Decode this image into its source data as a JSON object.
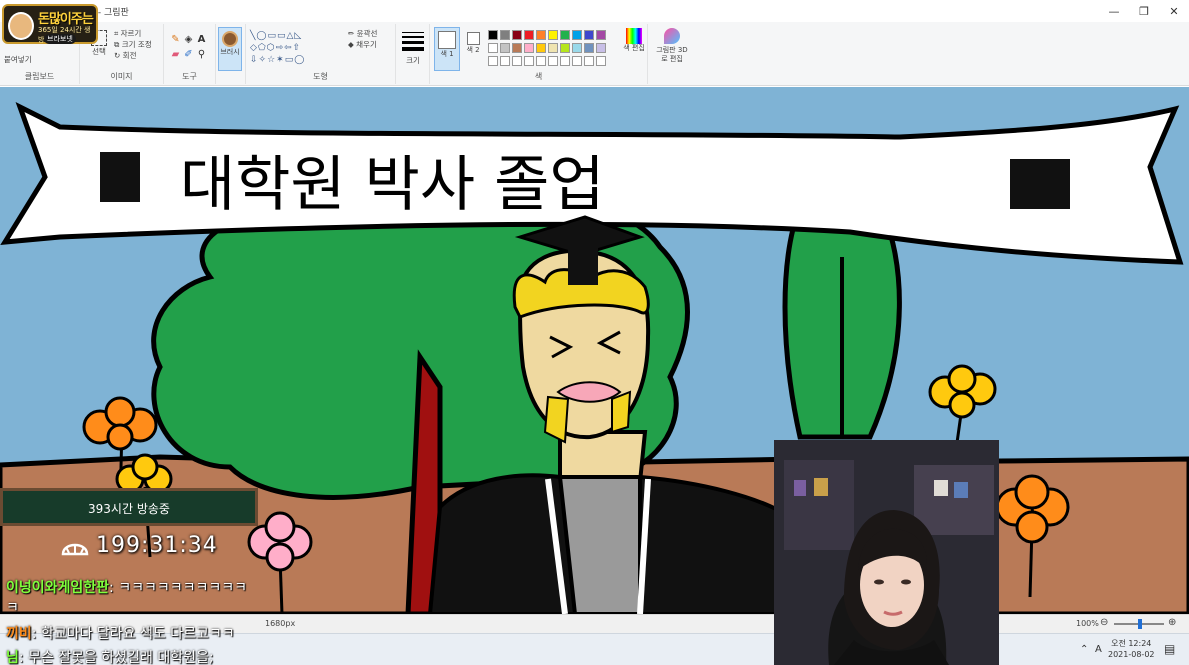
{
  "window": {
    "title": "제목 없음 - 그림판",
    "controls": [
      "—",
      "❐",
      "✕"
    ]
  },
  "ribbon": {
    "clipboard": {
      "paste_label": "붙여넣기",
      "group_label": "클립보드"
    },
    "image": {
      "select_label": "선택",
      "crop_label": "자르기",
      "resize_label": "크기 조정",
      "rotate_label": "회전",
      "group_label": "이미지"
    },
    "tools": {
      "group_label": "도구"
    },
    "brushes": {
      "label": "브러시"
    },
    "shapes": {
      "outline_label": "윤곽선",
      "fill_label": "채우기",
      "group_label": "도형"
    },
    "size": {
      "label": "크기"
    },
    "colors": {
      "color1_label": "색 1",
      "color2_label": "색 2",
      "edit_label": "색 편집",
      "group_label": "색",
      "palette_row1": [
        "#000000",
        "#7f7f7f",
        "#880015",
        "#ed1c24",
        "#ff7f27",
        "#fff200",
        "#22b14c",
        "#00a2e8",
        "#3f48cc",
        "#a349a4"
      ],
      "palette_row2": [
        "#ffffff",
        "#c3c3c3",
        "#b97a57",
        "#ffaec9",
        "#ffc90e",
        "#efe4b0",
        "#b5e61d",
        "#99d9ea",
        "#7092be",
        "#c8bfe7"
      ]
    },
    "paint3d": {
      "label": "그림판 3D로 편집"
    }
  },
  "canvas": {
    "banner_text": "대학원 박사 졸업",
    "colors": {
      "sky": "#7fb3d5",
      "ground": "#b97a57",
      "tree": "#22a04a",
      "banner": "#ffffff"
    }
  },
  "statusbar": {
    "size_text": "1680px",
    "zoom": "100%"
  },
  "taskbar": {
    "time": "오전 12:24",
    "date": "2021-08-02",
    "lang": "A"
  },
  "overlay": {
    "logo": {
      "title": "돈많이주는",
      "subtitle": "365일 24시간 생방송",
      "badge": "브라보넷"
    },
    "timer": {
      "label": "393시간 방송중",
      "clock": "199:31:34"
    },
    "chat": [
      {
        "user": "이넝이와게임한판",
        "message": "ㅋㅋㅋㅋㅋㅋㅋㅋㅋㅋ"
      },
      {
        "user": "",
        "message": "ㅋ"
      },
      {
        "user": "끼비",
        "message": "학교마다 달라요 색도 다르고ㅋㅋ"
      },
      {
        "user": "님",
        "message": "무슨 잘못을 하셨길래 대학원을;"
      }
    ]
  }
}
